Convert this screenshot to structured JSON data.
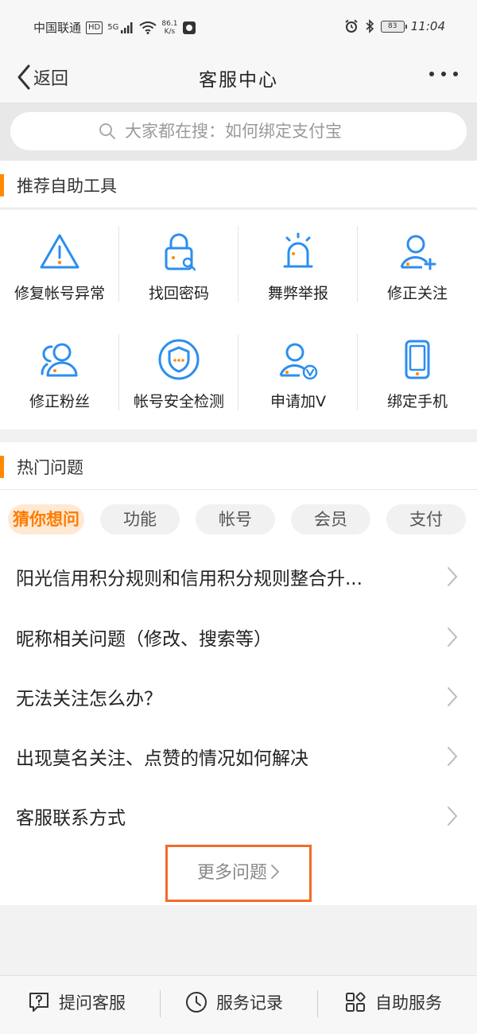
{
  "status_bar": {
    "carrier": "中国联通",
    "hd": "HD",
    "network": "5G",
    "net_speed": "86.1",
    "net_speed_unit": "K/s",
    "battery": "83",
    "time": "11:04"
  },
  "nav": {
    "back_label": "返回",
    "title": "客服中心"
  },
  "search": {
    "placeholder": "大家都在搜：如何绑定支付宝"
  },
  "tools_section": {
    "title": "推荐自助工具",
    "items": [
      {
        "label": "修复帐号异常",
        "icon": "warning-icon"
      },
      {
        "label": "找回密码",
        "icon": "lock-icon"
      },
      {
        "label": "舞弊举报",
        "icon": "alarm-icon"
      },
      {
        "label": "修正关注",
        "icon": "user-add-icon"
      },
      {
        "label": "修正粉丝",
        "icon": "users-icon"
      },
      {
        "label": "帐号安全检测",
        "icon": "shield-icon"
      },
      {
        "label": "申请加V",
        "icon": "user-verified-icon"
      },
      {
        "label": "绑定手机",
        "icon": "phone-icon"
      }
    ]
  },
  "hot_section": {
    "title": "热门问题",
    "chips": [
      "猜你想问",
      "功能",
      "帐号",
      "会员",
      "支付"
    ],
    "active_chip": "猜你想问",
    "questions": [
      "阳光信用积分规则和信用积分规则整合升...",
      "昵称相关问题（修改、搜索等）",
      "无法关注怎么办？",
      "出现莫名关注、点赞的情况如何解决",
      "客服联系方式"
    ],
    "more_label": "更多问题"
  },
  "bottom_bar": {
    "tabs": [
      {
        "label": "提问客服",
        "icon": "question-chat-icon"
      },
      {
        "label": "服务记录",
        "icon": "clock-icon"
      },
      {
        "label": "自助服务",
        "icon": "apps-icon"
      }
    ]
  },
  "colors": {
    "accent": "#ff8a00",
    "icon_blue": "#2b8ef0",
    "highlight_border": "#f36a2c"
  }
}
